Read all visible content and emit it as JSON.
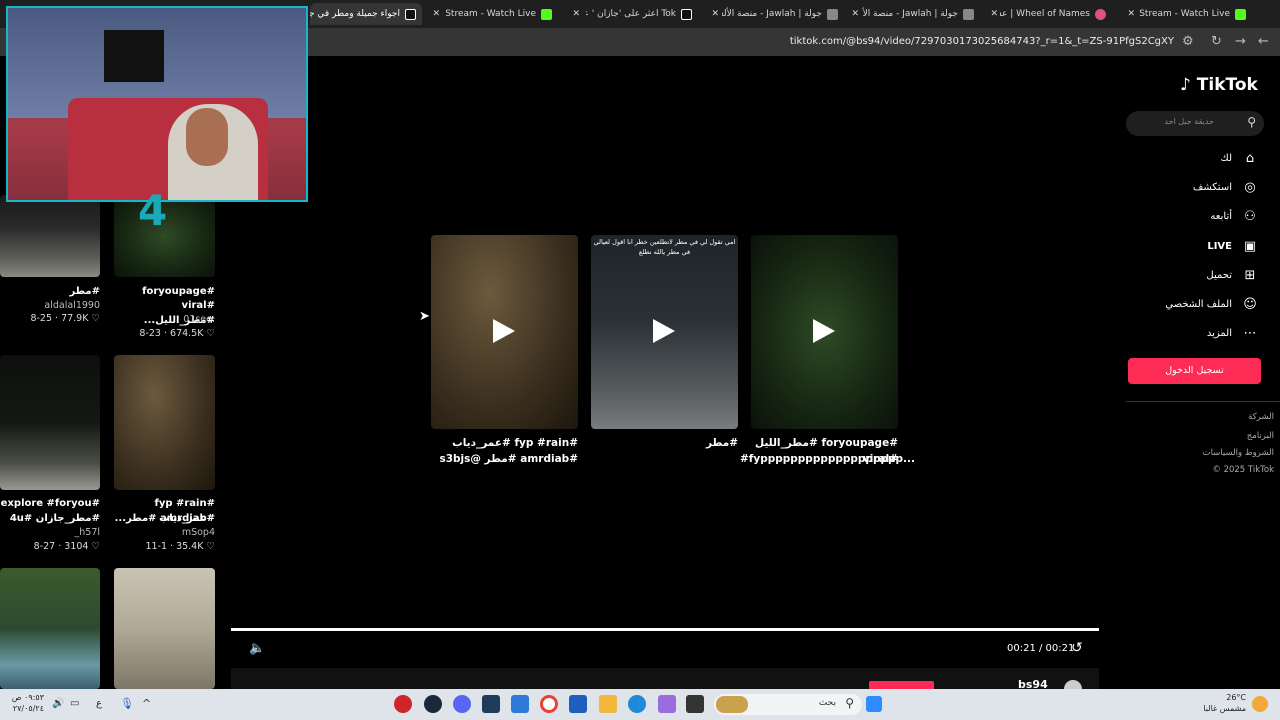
{
  "browser": {
    "tabs": [
      {
        "label": "اجواء جميلة ومطر في جدة",
        "color": "#ffffff"
      },
      {
        "label": "VOLKA Stream - Watch Live",
        "color": "#53fc18"
      },
      {
        "label": "Tok اعثر على 'جازان ' على",
        "color": "#ffffff"
      },
      {
        "label": "جولة | Jawlah - منصة الألعاب",
        "color": "#ffffff"
      },
      {
        "label": "جولة | Jawlah - منصة الألعاب",
        "color": "#ffffff"
      },
      {
        "label": "Wheel of Names | عشوائي",
        "color": "#e05080"
      },
      {
        "label": "iMartinx Stream - Watch Live",
        "color": "#53fc18"
      }
    ],
    "url": "tiktok.com/@bs94/video/7297030173025684743?_r=1&_t=ZS-91PfgS2CgXY"
  },
  "left_feed": {
    "items": [
      {
        "caption1": "#مطر",
        "caption2": "",
        "user": "aldalal1990",
        "stat": "8-25 · 77.9K ♡"
      },
      {
        "caption1": "#foryoupage",
        "caption2": "#viral #مطر_الليل...",
        "user": "01see.",
        "stat": "8-23 · 674.5K ♡"
      },
      {
        "caption1": "#explore #foryou",
        "caption2": "#مطر_جازان #4u",
        "user": "_h57l",
        "stat": "8-27 · 3104 ♡"
      },
      {
        "caption1": "#fyp #rain #عمر_دياب",
        "caption2": "#amrdiab #مطر...",
        "user": "mSop4",
        "stat": "11-1 · 35.4K ♡"
      }
    ]
  },
  "video_grid": [
    {
      "caption1": "#fyp #rain #عمر_دياب",
      "caption2": "#amrdiab #مطر @s3bjs",
      "overlay": ""
    },
    {
      "caption1": "#مطر",
      "caption2": "",
      "overlay": "امي تقول لي في مطر لاتطلعين خطر انا اقول لعيالي في مطر يالله نطلع"
    },
    {
      "caption1": "#foryoupage #مطر_الليل #viral",
      "caption2": "#fyppppppppppppppppppp...",
      "overlay": ""
    }
  ],
  "player": {
    "time": "00:21 / 00:21",
    "progress": 1.0
  },
  "sidebar": {
    "logo": "TikTok",
    "search_placeholder": "حديقة جبل احد",
    "nav": [
      {
        "label": "لك",
        "icon": "home-icon"
      },
      {
        "label": "استكشف",
        "icon": "compass-icon"
      },
      {
        "label": "أتابعه",
        "icon": "following-icon"
      },
      {
        "label": "LIVE",
        "icon": "live-icon"
      },
      {
        "label": "تحميل",
        "icon": "upload-icon"
      },
      {
        "label": "الملف الشخصي",
        "icon": "profile-icon"
      },
      {
        "label": "المزيد",
        "icon": "more-icon"
      }
    ],
    "login": "تسجيل الدخول",
    "footer": [
      "الشركة",
      "البرنامج",
      "الشروط والسياسات",
      "© 2025 TikTok"
    ]
  },
  "bottom_user": "bs94",
  "taskbar": {
    "search": "بحث",
    "weather_temp": "26°C",
    "weather_desc": "مشمس غالبا",
    "time": "٠٩:٥٣ ص",
    "date": "٢٧/٠٥/٢٤",
    "lang": "ع"
  }
}
